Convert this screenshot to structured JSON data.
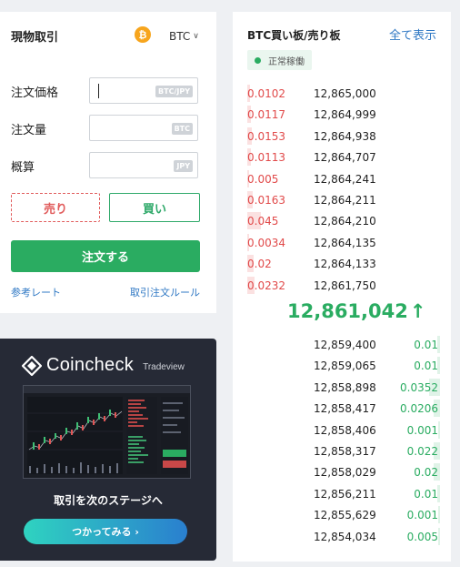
{
  "trade": {
    "title": "現物取引",
    "coin_symbol": "₿",
    "currency": "BTC",
    "fields": [
      {
        "label": "注文価格",
        "unit": "BTC/JPY",
        "value": ""
      },
      {
        "label": "注文量",
        "unit": "BTC",
        "value": ""
      },
      {
        "label": "概算",
        "unit": "JPY",
        "value": ""
      }
    ],
    "sell_label": "売り",
    "buy_label": "買い",
    "order_label": "注文する",
    "ref_rate_link": "参考レート",
    "rules_link": "取引注文ルール"
  },
  "ad": {
    "brand": "Coincheck",
    "sub": "Tradeview",
    "caption": "取引を次のステージへ",
    "cta": "つかってみる ›"
  },
  "orderbook": {
    "title": "BTC買い板/売り板",
    "show_all": "全て表示",
    "status": "正常稼働",
    "asks": [
      {
        "qty": "0.0102",
        "price": "12,865,000",
        "depth": 0.06
      },
      {
        "qty": "0.0117",
        "price": "12,864,999",
        "depth": 0.07
      },
      {
        "qty": "0.0153",
        "price": "12,864,938",
        "depth": 0.09
      },
      {
        "qty": "0.0113",
        "price": "12,864,707",
        "depth": 0.07
      },
      {
        "qty": "0.005",
        "price": "12,864,241",
        "depth": 0.03
      },
      {
        "qty": "0.0163",
        "price": "12,864,211",
        "depth": 0.1
      },
      {
        "qty": "0.045",
        "price": "12,864,210",
        "depth": 0.27
      },
      {
        "qty": "0.0034",
        "price": "12,864,135",
        "depth": 0.02
      },
      {
        "qty": "0.02",
        "price": "12,864,133",
        "depth": 0.12
      },
      {
        "qty": "0.0232",
        "price": "12,861,750",
        "depth": 0.14
      }
    ],
    "last_price": "12,861,042",
    "last_arrow": "↑",
    "bids": [
      {
        "price": "12,859,400",
        "qty": "0.01",
        "depth": 0.06
      },
      {
        "price": "12,859,065",
        "qty": "0.01",
        "depth": 0.06
      },
      {
        "price": "12,858,898",
        "qty": "0.0352",
        "depth": 0.21
      },
      {
        "price": "12,858,417",
        "qty": "0.0206",
        "depth": 0.12
      },
      {
        "price": "12,858,406",
        "qty": "0.001",
        "depth": 0.01
      },
      {
        "price": "12,858,317",
        "qty": "0.022",
        "depth": 0.13
      },
      {
        "price": "12,858,029",
        "qty": "0.02",
        "depth": 0.12
      },
      {
        "price": "12,856,211",
        "qty": "0.01",
        "depth": 0.06
      },
      {
        "price": "12,855,629",
        "qty": "0.001",
        "depth": 0.01
      },
      {
        "price": "12,854,034",
        "qty": "0.005",
        "depth": 0.03
      }
    ]
  },
  "colors": {
    "buy_green": "#2aac61",
    "sell_red": "#e14a4a",
    "link_blue": "#2f78c4",
    "btc_orange": "#f7a51d"
  }
}
